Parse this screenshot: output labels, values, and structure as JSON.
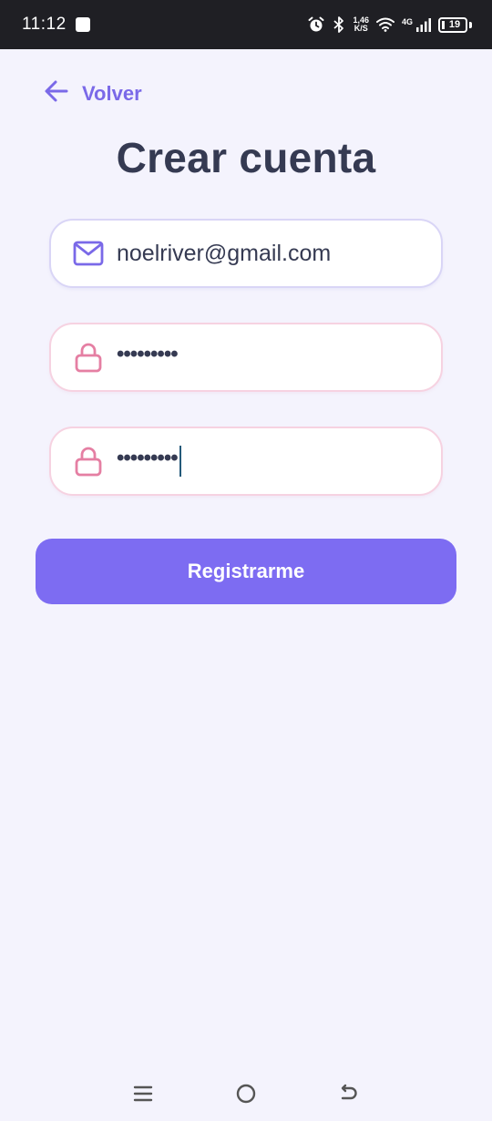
{
  "status_bar": {
    "time": "11:12",
    "net_speed_value": "1,46",
    "net_speed_unit": "K/S",
    "network_type": "4G",
    "battery": "19",
    "icons": [
      "alarm-icon",
      "bluetooth-icon",
      "wifi-icon",
      "signal-icon",
      "battery-icon"
    ]
  },
  "header": {
    "back_label": "Volver",
    "title": "Crear cuenta"
  },
  "form": {
    "email_value": "noelriver@gmail.com",
    "password_value": "•••••••••",
    "confirm_password_value": "•••••••••",
    "submit_label": "Registrarme"
  },
  "colors": {
    "accent": "#7d6cf2",
    "title": "#353a52",
    "background": "#f4f3fd",
    "lock_icon": "#e57fa3"
  },
  "nav_bar": {
    "icons": [
      "menu-icon",
      "home-icon",
      "back-icon"
    ]
  }
}
